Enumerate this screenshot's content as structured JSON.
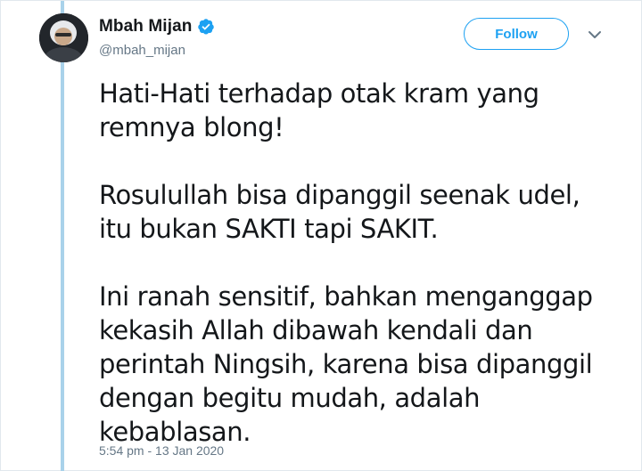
{
  "tweet": {
    "author": {
      "display_name": "Mbah Mijan",
      "handle": "@mbah_mijan",
      "verified": true
    },
    "follow_label": "Follow",
    "paragraphs": [
      "Hati-Hati terhadap otak kram yang remnya blong!",
      "Rosulullah bisa dipanggil seenak udel, itu bukan SAKTI tapi SAKIT.",
      "Ini ranah sensitif, bahkan menganggap kekasih Allah dibawah kendali dan perintah Ningsih, karena bisa dipanggil dengan begitu mudah, adalah kebablasan."
    ],
    "timestamp": "5:54 pm - 13 Jan 2020"
  },
  "colors": {
    "accent": "#1da1f2",
    "thread_line": "#a9d2ea",
    "text_primary": "#14171a",
    "text_secondary": "#657786"
  },
  "icons": {
    "verified": "verified-badge-icon",
    "menu": "chevron-down-icon"
  }
}
